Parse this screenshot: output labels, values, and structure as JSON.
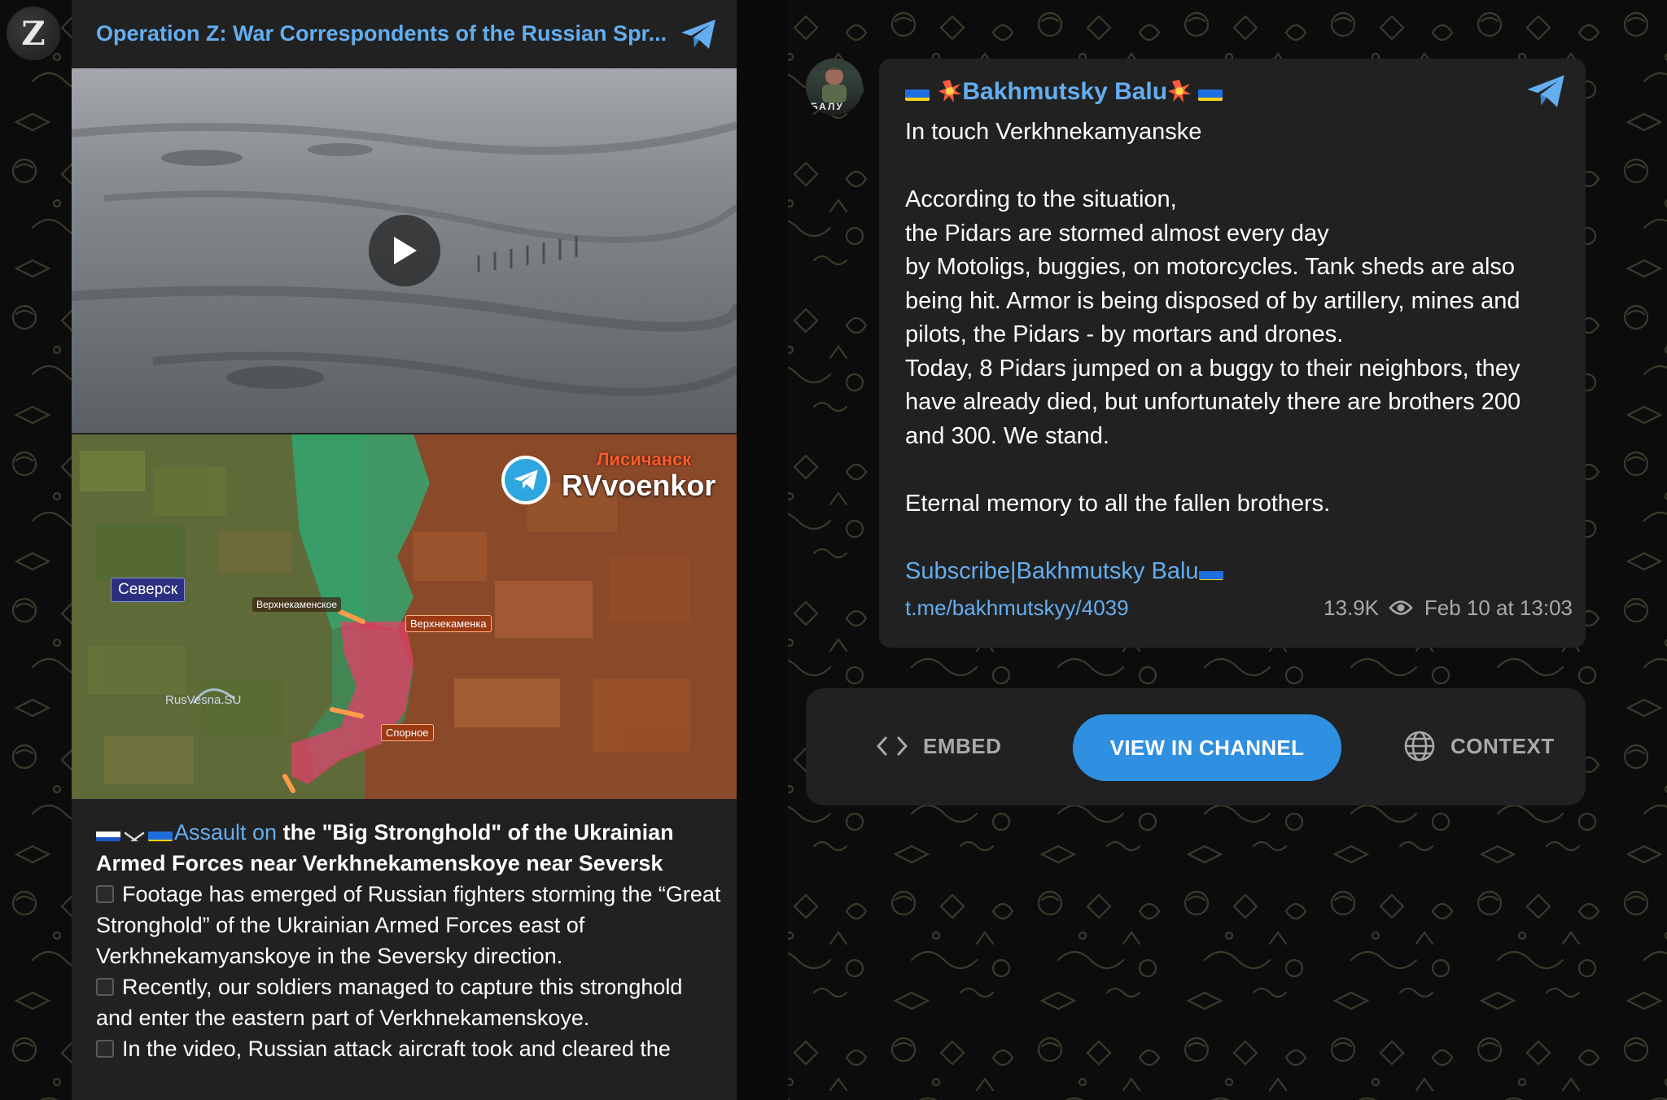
{
  "left_post": {
    "channel_title": "Operation Z: War Correspondents of the Russian Spr...",
    "avatar_letter": "Z",
    "video": {
      "play_label": "Play video"
    },
    "map": {
      "watermark": "RVvoenkor",
      "label_lysychansk": "Лисичанск",
      "label_seversk": "Северск",
      "label_verkhnekamenskoe": "Верхнекаменское",
      "label_verkhnekamenka": "Верхнекаменка",
      "label_spornoe": "Спорное",
      "label_rusvesna": "RusVesna.SU"
    },
    "text": {
      "link_part": "Assault on",
      "headline_rest": " the \"Big Stronghold\" of the Ukrainian Armed Forces near Verkhnekamenskoye near Seversk",
      "para1": "Footage has emerged of Russian fighters storming the “Great Stronghold” of the Ukrainian Armed Forces east of Verkhnekamyanskoye in the Seversky direction.",
      "para2": "Recently, our soldiers managed to capture this stronghold and enter the eastern part of Verkhnekamenskoye.",
      "para3": "In the video, Russian attack aircraft took and cleared the"
    }
  },
  "right_post": {
    "avatar_text": "БАЛУ",
    "channel_name": "Bakhmutsky Balu",
    "lines": [
      "In touch Verkhnekamyanske",
      "",
      "According to the situation,",
      "the Pidars are stormed almost every day",
      "by Motoligs, buggies, on motorcycles. Tank sheds are also",
      "being hit. Armor is being disposed of by artillery, mines and",
      "pilots, the Pidars - by mortars and drones.",
      "Today, 8 Pidars jumped on a buggy to their neighbors, they",
      "have already died, but unfortunately there are brothers 200",
      "and 300. We stand.",
      "",
      "Eternal memory to all the fallen brothers.",
      ""
    ],
    "subscribe": "Subscribe|Bakhmutsky Balu",
    "link": "t.me/bakhmutskyy/4039",
    "views": "13.9K",
    "date": "Feb 10 at 13:03"
  },
  "actions": {
    "embed": "EMBED",
    "view_in_channel": "VIEW IN CHANNEL",
    "context": "CONTEXT"
  },
  "colors": {
    "link_blue": "#64aef0",
    "button_blue": "#2f8fe0",
    "card_bg": "#212121",
    "page_bg": "#0c0c0c"
  }
}
